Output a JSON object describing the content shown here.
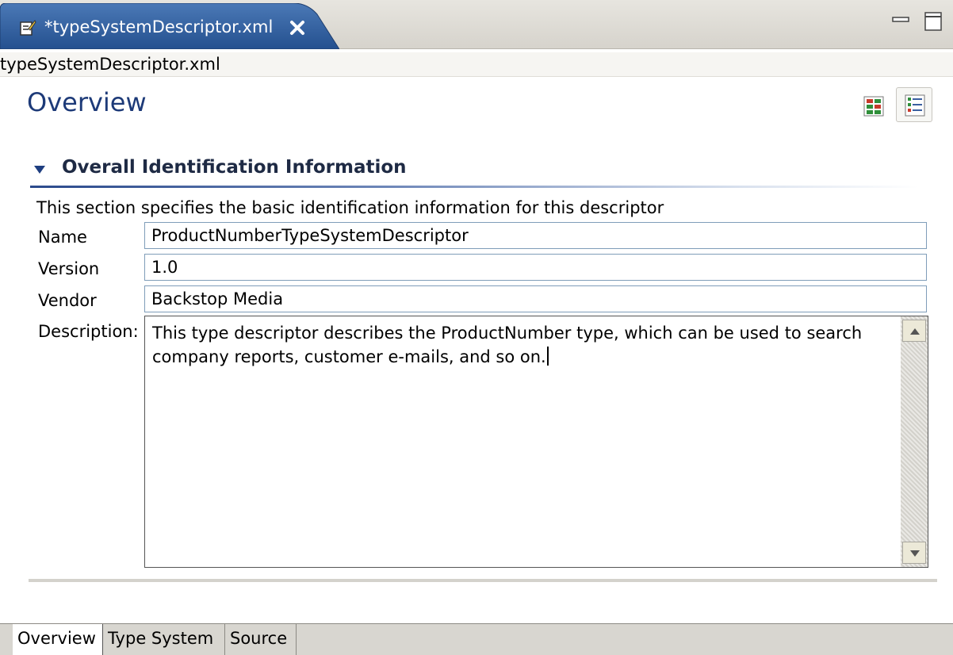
{
  "editor_tab": {
    "title": "*typeSystemDescriptor.xml",
    "icon": "xml-edit-icon",
    "close_icon": "close-icon",
    "color": "#2f5f9e"
  },
  "window_controls": {
    "minimize": "minimize-icon",
    "maximize": "maximize-icon"
  },
  "file_path": "typeSystemDescriptor.xml",
  "page": {
    "title": "Overview",
    "title_color": "#1d3a78"
  },
  "layout_buttons": [
    "horizontal-layout-icon",
    "vertical-layout-icon"
  ],
  "section": {
    "title": "Overall Identification Information",
    "toggle_icon": "chevron-down-icon",
    "description": "This section specifies the basic identification information for this descriptor"
  },
  "fields": {
    "name": {
      "label": "Name",
      "value": "ProductNumberTypeSystemDescriptor"
    },
    "version": {
      "label": "Version",
      "value": "1.0"
    },
    "vendor": {
      "label": "Vendor",
      "value": "Backstop Media"
    },
    "description": {
      "label": "Description:",
      "value": "This type descriptor describes the ProductNumber type, which can be used to search company reports, customer e-mails, and so on."
    }
  },
  "bottom_tabs": [
    {
      "label": "Overview",
      "active": true
    },
    {
      "label": "Type System",
      "active": false
    },
    {
      "label": "Source",
      "active": false
    }
  ]
}
